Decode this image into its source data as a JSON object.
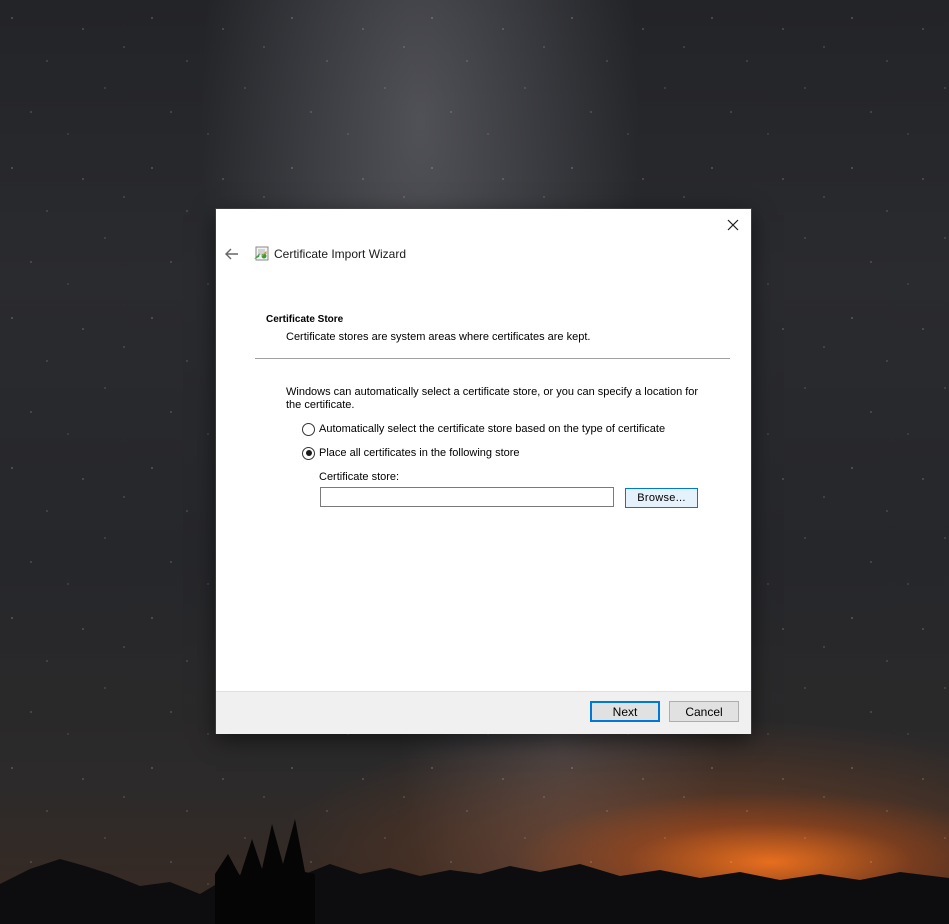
{
  "wizard": {
    "title": "Certificate Import Wizard",
    "icons": {
      "back": "back-arrow-icon",
      "wizard": "certificate-wizard-icon",
      "close": "close-icon"
    }
  },
  "page": {
    "section_title": "Certificate Store",
    "section_description": "Certificate stores are system areas where certificates are kept.",
    "intro_text": "Windows can automatically select a certificate store, or you can specify a location for the certificate.",
    "options": [
      {
        "label": "Automatically select the certificate store based on the type of certificate",
        "checked": false
      },
      {
        "label": "Place all certificates in the following store",
        "checked": true
      }
    ],
    "store_field": {
      "label": "Certificate store:",
      "value": "",
      "browse_label": "Browse..."
    }
  },
  "footer": {
    "next_label": "Next",
    "cancel_label": "Cancel"
  },
  "colors": {
    "accent": "#0078d7",
    "footer_bg": "#f0f0f0",
    "dialog_bg": "#ffffff"
  }
}
